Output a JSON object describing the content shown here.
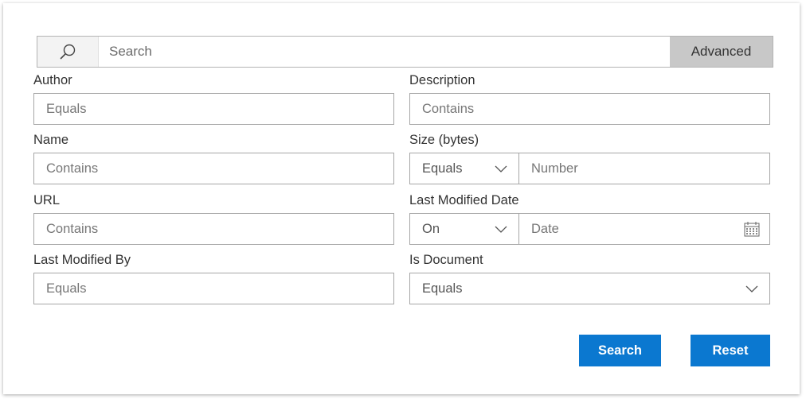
{
  "search": {
    "placeholder": "Search",
    "advanced_label": "Advanced"
  },
  "fields": {
    "author": {
      "label": "Author",
      "placeholder": "Equals"
    },
    "description": {
      "label": "Description",
      "placeholder": "Contains"
    },
    "name": {
      "label": "Name",
      "placeholder": "Contains"
    },
    "size": {
      "label": "Size (bytes)",
      "operator": "Equals",
      "placeholder": "Number"
    },
    "url": {
      "label": "URL",
      "placeholder": "Contains"
    },
    "last_modified_date": {
      "label": "Last Modified Date",
      "operator": "On",
      "placeholder": "Date"
    },
    "last_modified_by": {
      "label": "Last Modified By",
      "placeholder": "Equals"
    },
    "is_document": {
      "label": "Is Document",
      "operator": "Equals"
    }
  },
  "actions": {
    "search_label": "Search",
    "reset_label": "Reset"
  },
  "colors": {
    "primary": "#0b78d0",
    "advanced_bg": "#c8c8c8",
    "border": "#a6a6a6"
  },
  "icons": {
    "search": "search-icon",
    "chevron": "chevron-down-icon",
    "calendar": "calendar-icon"
  }
}
